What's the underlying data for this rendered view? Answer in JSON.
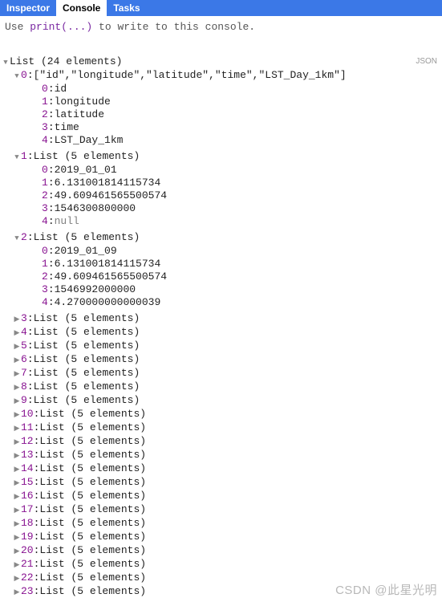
{
  "tabs": {
    "inspector": "Inspector",
    "console": "Console",
    "tasks": "Tasks"
  },
  "hint_prefix": "Use ",
  "hint_fn": "print(...)",
  "hint_suffix": " to write to this console.",
  "json_badge": "JSON",
  "root_label": "List (24 elements)",
  "item0": {
    "key": "0",
    "header": "[\"id\",\"longitude\",\"latitude\",\"time\",\"LST_Day_1km\"]",
    "c0k": "0",
    "c0v": "id",
    "c1k": "1",
    "c1v": "longitude",
    "c2k": "2",
    "c2v": "latitude",
    "c3k": "3",
    "c3v": "time",
    "c4k": "4",
    "c4v": "LST_Day_1km"
  },
  "item1": {
    "key": "1",
    "header": "List (5 elements)",
    "c0k": "0",
    "c0v": "2019_01_01",
    "c1k": "1",
    "c1v": "6.131001814115734",
    "c2k": "2",
    "c2v": "49.609461565500574",
    "c3k": "3",
    "c3v": "1546300800000",
    "c4k": "4",
    "c4v": "null"
  },
  "item2": {
    "key": "2",
    "header": "List (5 elements)",
    "c0k": "0",
    "c0v": "2019_01_09",
    "c1k": "1",
    "c1v": "6.131001814115734",
    "c2k": "2",
    "c2v": "49.609461565500574",
    "c3k": "3",
    "c3v": "1546992000000",
    "c4k": "4",
    "c4v": "4.270000000000039"
  },
  "collapsed": [
    {
      "key": "3",
      "label": "List (5 elements)"
    },
    {
      "key": "4",
      "label": "List (5 elements)"
    },
    {
      "key": "5",
      "label": "List (5 elements)"
    },
    {
      "key": "6",
      "label": "List (5 elements)"
    },
    {
      "key": "7",
      "label": "List (5 elements)"
    },
    {
      "key": "8",
      "label": "List (5 elements)"
    },
    {
      "key": "9",
      "label": "List (5 elements)"
    },
    {
      "key": "10",
      "label": "List (5 elements)"
    },
    {
      "key": "11",
      "label": "List (5 elements)"
    },
    {
      "key": "12",
      "label": "List (5 elements)"
    },
    {
      "key": "13",
      "label": "List (5 elements)"
    },
    {
      "key": "14",
      "label": "List (5 elements)"
    },
    {
      "key": "15",
      "label": "List (5 elements)"
    },
    {
      "key": "16",
      "label": "List (5 elements)"
    },
    {
      "key": "17",
      "label": "List (5 elements)"
    },
    {
      "key": "18",
      "label": "List (5 elements)"
    },
    {
      "key": "19",
      "label": "List (5 elements)"
    },
    {
      "key": "20",
      "label": "List (5 elements)"
    },
    {
      "key": "21",
      "label": "List (5 elements)"
    },
    {
      "key": "22",
      "label": "List (5 elements)"
    },
    {
      "key": "23",
      "label": "List (5 elements)"
    }
  ],
  "watermark": "CSDN @此星光明"
}
